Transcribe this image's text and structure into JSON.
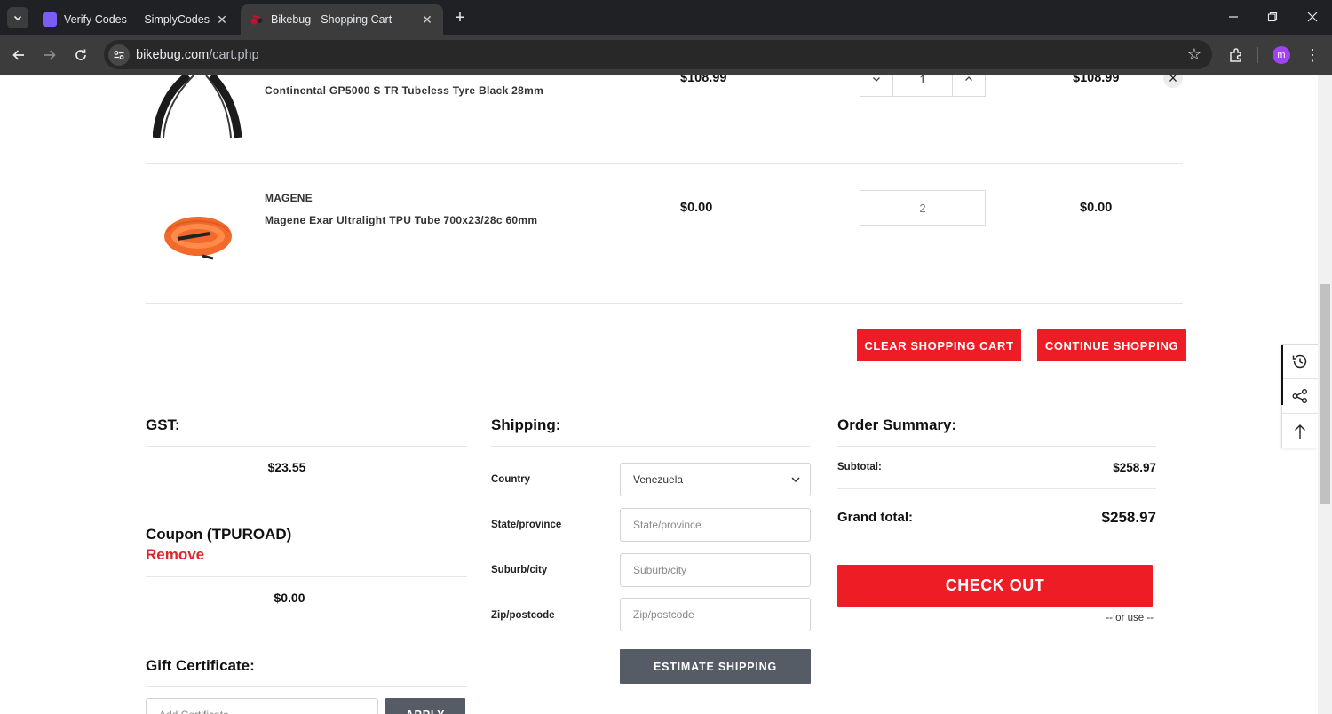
{
  "browser": {
    "tabs": [
      {
        "title": "Verify Codes — SimplyCodes",
        "favicon_color": "#7b5cf5",
        "active": false
      },
      {
        "title": "Bikebug - Shopping Cart",
        "favicon_color": "#c8102e",
        "active": true
      }
    ],
    "url_host": "bikebug.com",
    "url_path": "/cart.php",
    "profile_initial": "m"
  },
  "cart": {
    "items": [
      {
        "brand": "",
        "name": "Continental GP5000 S TR Tubeless Tyre Black 28mm",
        "price": "$108.99",
        "quantity": "1",
        "total": "$108.99"
      },
      {
        "brand": "MAGENE",
        "name": "Magene Exar Ultralight TPU Tube 700x23/28c 60mm",
        "price": "$0.00",
        "quantity": "2",
        "total": "$0.00"
      }
    ],
    "clear_label": "CLEAR SHOPPING CART",
    "continue_label": "CONTINUE SHOPPING"
  },
  "gst": {
    "title": "GST:",
    "value": "$23.55"
  },
  "coupon": {
    "title": "Coupon (TPUROAD)",
    "remove_label": "Remove",
    "value": "$0.00"
  },
  "gift": {
    "title": "Gift Certificate:",
    "placeholder": "Add Certificate",
    "apply_label": "APPLY"
  },
  "shipping": {
    "title": "Shipping:",
    "country_label": "Country",
    "country_value": "Venezuela",
    "state_label": "State/province",
    "state_placeholder": "State/province",
    "city_label": "Suburb/city",
    "city_placeholder": "Suburb/city",
    "zip_label": "Zip/postcode",
    "zip_placeholder": "Zip/postcode",
    "estimate_label": "ESTIMATE SHIPPING"
  },
  "summary": {
    "title": "Order Summary:",
    "subtotal_label": "Subtotal:",
    "subtotal_value": "$258.97",
    "grand_label": "Grand total:",
    "grand_value": "$258.97",
    "checkout_label": "CHECK OUT",
    "or_use": "-- or use --"
  },
  "colors": {
    "accent_red": "#ee1c25",
    "button_grey": "#555c66",
    "remove_red": "#e0242c"
  }
}
